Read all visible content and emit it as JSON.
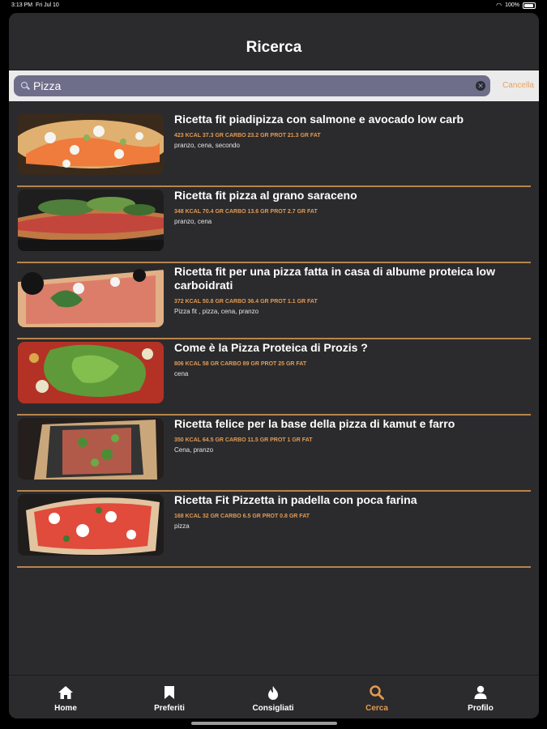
{
  "status": {
    "time": "3:13 PM",
    "date": "Fri Jul 10",
    "battery": "100%"
  },
  "header": {
    "title": "Ricerca"
  },
  "search": {
    "value": "Pizza",
    "cancel_label": "Cancella"
  },
  "recipes": [
    {
      "title": "Ricetta fit piadipizza con salmone e avocado low carb",
      "macros": "423 KCAL 37.3 GR CARBO 23.2 GR PROT 21.3 GR FAT",
      "tags": "pranzo, cena, secondo"
    },
    {
      "title": "Ricetta fit pizza al grano saraceno",
      "macros": "348 KCAL 70.4 GR CARBO 13.6 GR PROT 2.7 GR FAT",
      "tags": "pranzo, cena"
    },
    {
      "title": "Ricetta fit per una pizza fatta in casa di albume proteica low carboidrati",
      "macros": "372 KCAL 50.8 GR CARBO 36.4 GR PROT 1.1 GR FAT",
      "tags": "Pizza fit , pizza, cena, pranzo"
    },
    {
      "title": "Come è la Pizza Proteica di Prozis ?",
      "macros": "806 KCAL 58 GR CARBO 89 GR PROT 25 GR FAT",
      "tags": "cena"
    },
    {
      "title": "Ricetta felice per la base della pizza di kamut e farro",
      "macros": "350 KCAL 64.5 GR CARBO 11.5 GR PROT 1 GR FAT",
      "tags": "Cena, pranzo"
    },
    {
      "title": "Ricetta Fit Pizzetta in padella con poca farina",
      "macros": "168 KCAL 32 GR CARBO 6.5 GR PROT 0.8 GR FAT",
      "tags": "pizza"
    }
  ],
  "tabs": [
    {
      "label": "Home",
      "icon": "house-icon"
    },
    {
      "label": "Preferiti",
      "icon": "bookmark-icon"
    },
    {
      "label": "Consigliati",
      "icon": "flame-icon"
    },
    {
      "label": "Cerca",
      "icon": "search-icon"
    },
    {
      "label": "Profilo",
      "icon": "person-icon"
    }
  ],
  "colors": {
    "accent": "#e59a4e",
    "divider": "#b8844b",
    "background": "#2b2b2d"
  }
}
